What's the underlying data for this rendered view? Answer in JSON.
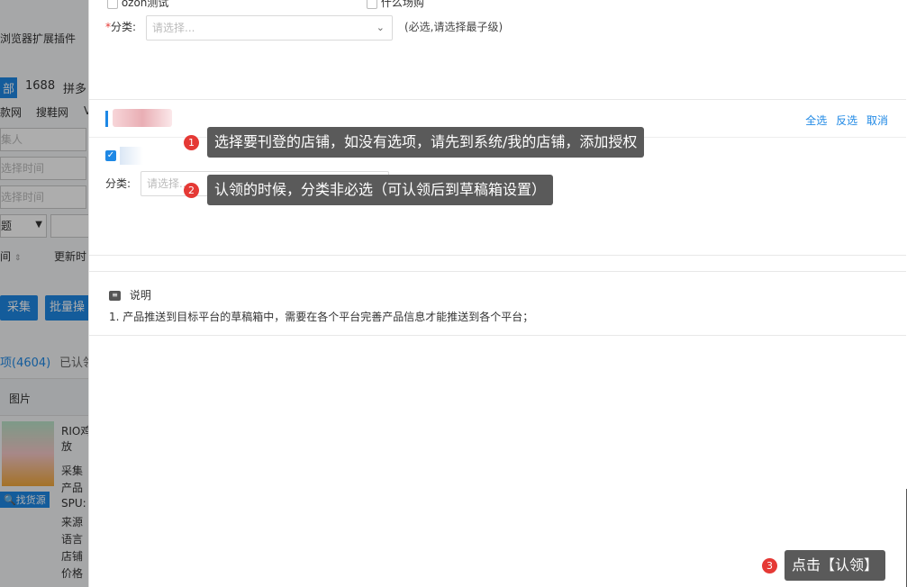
{
  "background": {
    "plugin_text": "浏览器扩展插件",
    "tab_all": "部",
    "source_1688": "1688",
    "source_pdd": "拼多",
    "source_kuan": "款网",
    "source_souxie": "搜鞋网",
    "source_v": "V",
    "collector_ph": "集人",
    "time_ph_1": "选择时间",
    "time_ph_2": "选择时间",
    "title_select": "题",
    "sort_time": "间",
    "update_time": "更新时",
    "btn_collect": "采集",
    "btn_batch": "批量操",
    "count_tab": "项(4604)",
    "claimed_tab": "已认领",
    "col_image": "图片",
    "prod_1": "RIO鸡",
    "prod_2": "放",
    "find_source": "找货源",
    "meta_1": "采集",
    "meta_2": "产品",
    "meta_3": "SPU:",
    "meta_4": "来源",
    "meta_5": "语言",
    "meta_6": "店铺",
    "meta_7": "价格"
  },
  "drawer": {
    "top_options": {
      "opt1": "ozon测试",
      "opt2": "什么场购"
    },
    "category": {
      "required_mark": "*",
      "label": "分类:",
      "placeholder": "请选择...",
      "hint": "(必选,请选择最子级)"
    },
    "shops": {
      "select_all": "全选",
      "invert": "反选",
      "cancel": "取消",
      "category_label": "分类:",
      "category_placeholder": "请选择..."
    },
    "notes": {
      "title": "说明",
      "line1": "1. 产品推送到目标平台的草稿箱中，需要在各个平台完善产品信息才能推送到各个平台；"
    }
  },
  "tips": [
    {
      "num": "1",
      "text": "选择要刊登的店铺，如没有选项，请先到系统/我的店铺，添加授权"
    },
    {
      "num": "2",
      "text": "认领的时候，分类非必选（可认领后到草稿箱设置）"
    },
    {
      "num": "3",
      "text": "点击【认领】"
    }
  ],
  "colors": {
    "accent": "#1e88e5",
    "badge": "#e53935",
    "tooltip": "#5a5a5a"
  }
}
